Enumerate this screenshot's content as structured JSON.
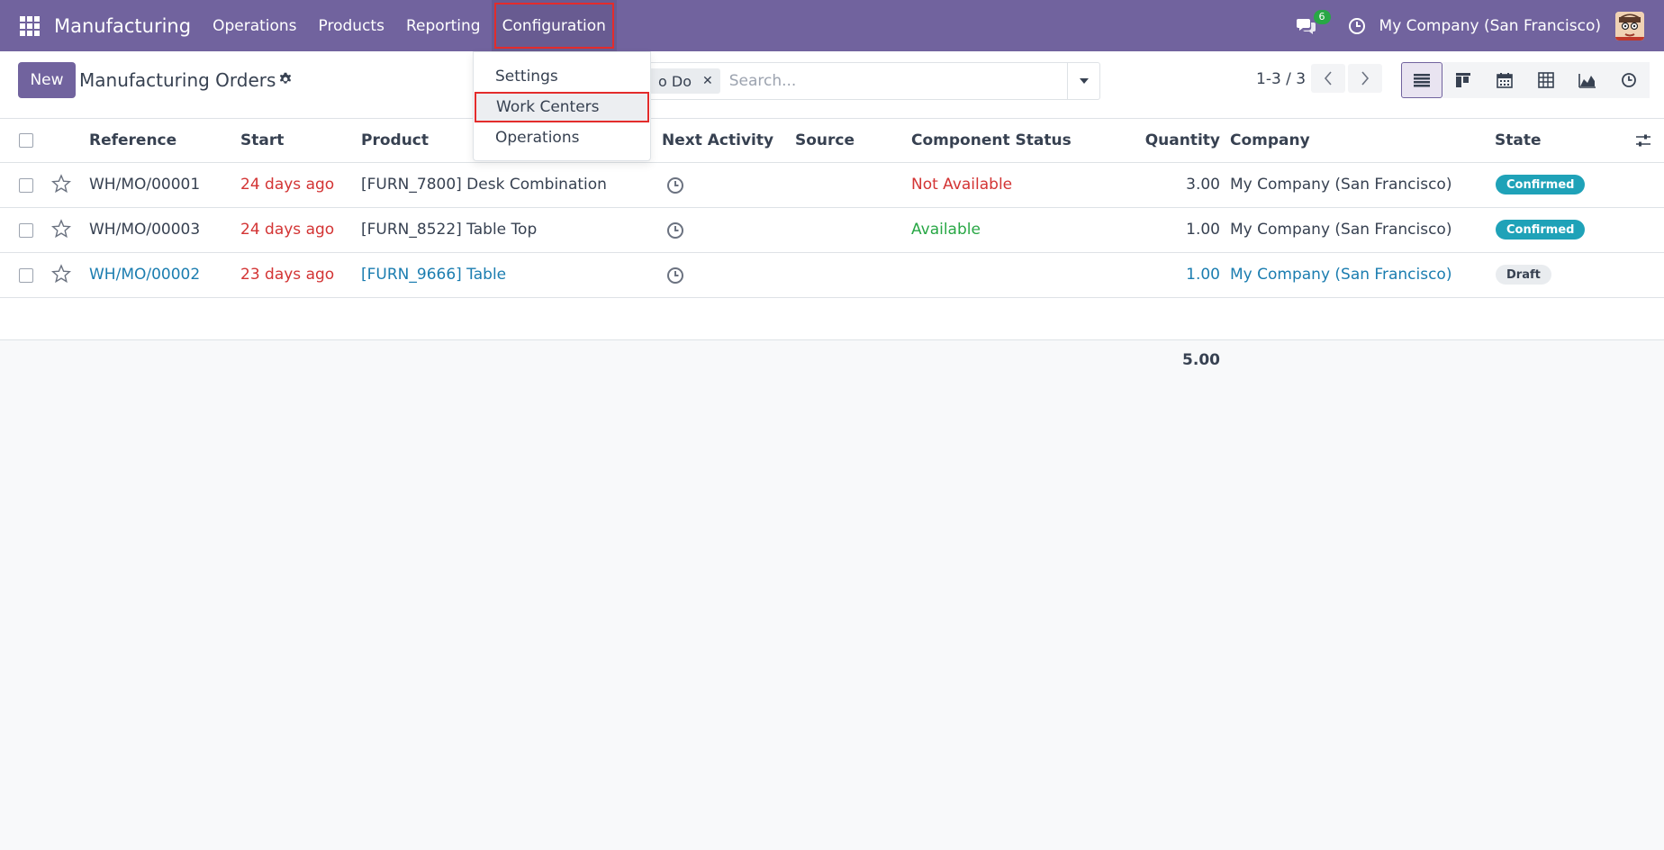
{
  "navbar": {
    "app_name": "Manufacturing",
    "menu": [
      "Operations",
      "Products",
      "Reporting",
      "Configuration"
    ],
    "chat_badge": "6",
    "company": "My Company (San Francisco)",
    "bg_color": "#71639e"
  },
  "dropdown": {
    "items": [
      "Settings",
      "Work Centers",
      "Operations"
    ],
    "highlighted": "Work Centers"
  },
  "control": {
    "new_label": "New",
    "title": "Manufacturing Orders",
    "facet_label": "o Do",
    "search_placeholder": "Search...",
    "pager": "1-3 / 3",
    "views": [
      "list-view-icon",
      "kanban-view-icon",
      "calendar-view-icon",
      "pivot-view-icon",
      "graph-view-icon",
      "activity-view-icon"
    ],
    "active_view": "list-view-icon"
  },
  "table": {
    "headers": {
      "reference": "Reference",
      "start": "Start",
      "product": "Product",
      "next_activity": "Next Activity",
      "source": "Source",
      "component_status": "Component Status",
      "quantity": "Quantity",
      "company": "Company",
      "state": "State"
    },
    "rows": [
      {
        "reference": "WH/MO/00001",
        "start": "24 days ago",
        "product": "[FURN_7800] Desk Combination",
        "component_status": "Not Available",
        "quantity": "3.00",
        "company": "My Company (San Francisco)",
        "state": "Confirmed"
      },
      {
        "reference": "WH/MO/00003",
        "start": "24 days ago",
        "product": "[FURN_8522] Table Top",
        "component_status": "Available",
        "quantity": "1.00",
        "company": "My Company (San Francisco)",
        "state": "Confirmed"
      },
      {
        "reference": "WH/MO/00002",
        "start": "23 days ago",
        "product": "[FURN_9666] Table",
        "component_status": "",
        "quantity": "1.00",
        "company": "My Company (San Francisco)",
        "state": "Draft"
      }
    ],
    "total_quantity": "5.00"
  }
}
